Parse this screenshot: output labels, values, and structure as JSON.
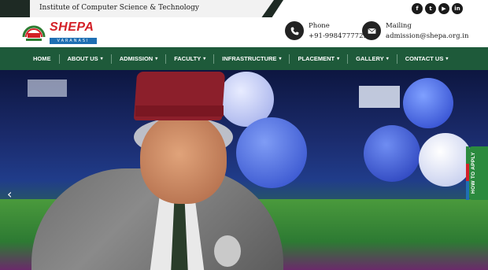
{
  "topbar": {
    "institute": "Institute of Computer Science & Technology",
    "social": [
      {
        "icon": "facebook-icon",
        "glyph": "f"
      },
      {
        "icon": "twitter-icon",
        "glyph": "t"
      },
      {
        "icon": "youtube-icon",
        "glyph": "▶"
      },
      {
        "icon": "linkedin-icon",
        "glyph": "in"
      }
    ]
  },
  "header": {
    "logo": {
      "word": "SHEPA",
      "city": "VARANASI"
    },
    "phone": {
      "title": "Phone",
      "value": "+91-9984777729"
    },
    "mail": {
      "title": "Mailing",
      "value": "admission@shepa.org.in"
    }
  },
  "nav": {
    "items": [
      {
        "label": "HOME",
        "dropdown": false
      },
      {
        "label": "ABOUT US",
        "dropdown": true
      },
      {
        "label": "ADMISSION",
        "dropdown": true
      },
      {
        "label": "FACULTY",
        "dropdown": true
      },
      {
        "label": "INFRASTRUCTURE",
        "dropdown": true
      },
      {
        "label": "PLACEMENT",
        "dropdown": true
      },
      {
        "label": "GALLERY",
        "dropdown": true
      },
      {
        "label": "CONTACT US",
        "dropdown": true
      }
    ]
  },
  "hero": {
    "prev_glyph": "‹",
    "how_to_apply": "HOW TO APPLY"
  },
  "colors": {
    "nav_bg": "#1e5a3a",
    "brand_red": "#d32027",
    "apply_green": "#2b8a3e"
  }
}
